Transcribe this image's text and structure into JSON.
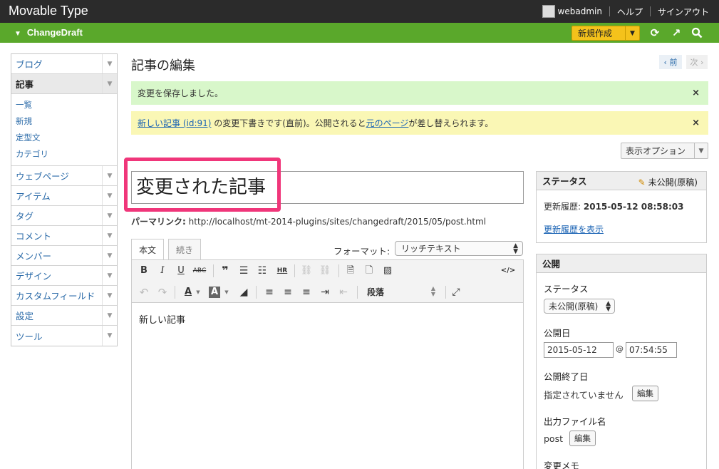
{
  "app": {
    "brand": "Movable Type",
    "user": "webadmin",
    "help": "ヘルプ",
    "signout": "サインアウト"
  },
  "blogbar": {
    "site_name": "ChangeDraft",
    "new_button": "新規作成"
  },
  "menu": {
    "items": [
      {
        "label": "ブログ"
      },
      {
        "label": "記事"
      },
      {
        "label": "ウェブページ"
      },
      {
        "label": "アイテム"
      },
      {
        "label": "タグ"
      },
      {
        "label": "コメント"
      },
      {
        "label": "メンバー"
      },
      {
        "label": "デザイン"
      },
      {
        "label": "カスタムフィールド"
      },
      {
        "label": "設定"
      },
      {
        "label": "ツール"
      }
    ],
    "sub_items": [
      "一覧",
      "新規",
      "定型文",
      "カテゴリ"
    ]
  },
  "main": {
    "page_title": "記事の編集",
    "prev": "‹ 前",
    "next": "次 ›",
    "msg_saved": "変更を保存しました。",
    "msg_info_link1": "新しい記事 (id:91)",
    "msg_info_mid": " の変更下書きです(直前)。公開されると",
    "msg_info_link2": "元のページ",
    "msg_info_end": "が差し替えられます。",
    "display_options": "表示オプション",
    "title_value": "変更された記事",
    "permalink_label": "パーマリンク:",
    "permalink_url": "http://localhost/mt-2014-plugins/sites/changedraft/2015/05/post.html",
    "tab_body": "本文",
    "tab_more": "続き",
    "format_label": "フォーマット:",
    "format_value": "リッチテキスト",
    "paragraph": "段落",
    "body_text": "新しい記事"
  },
  "status_panel": {
    "title": "ステータス",
    "state": "未公開(原稿)",
    "history_label": "更新履歴:",
    "history_value": "2015-05-12 08:58:03",
    "history_link": "更新履歴を表示"
  },
  "publish_panel": {
    "title": "公開",
    "status_label": "ステータス",
    "status_value": "未公開(原稿)",
    "date_label": "公開日",
    "date_value": "2015-05-12",
    "at": "@",
    "time_value": "07:54:55",
    "end_label": "公開終了日",
    "end_value": "指定されていません",
    "edit_button": "編集",
    "filename_label": "出力ファイル名",
    "filename_value": "post",
    "memo_label": "変更メモ"
  }
}
